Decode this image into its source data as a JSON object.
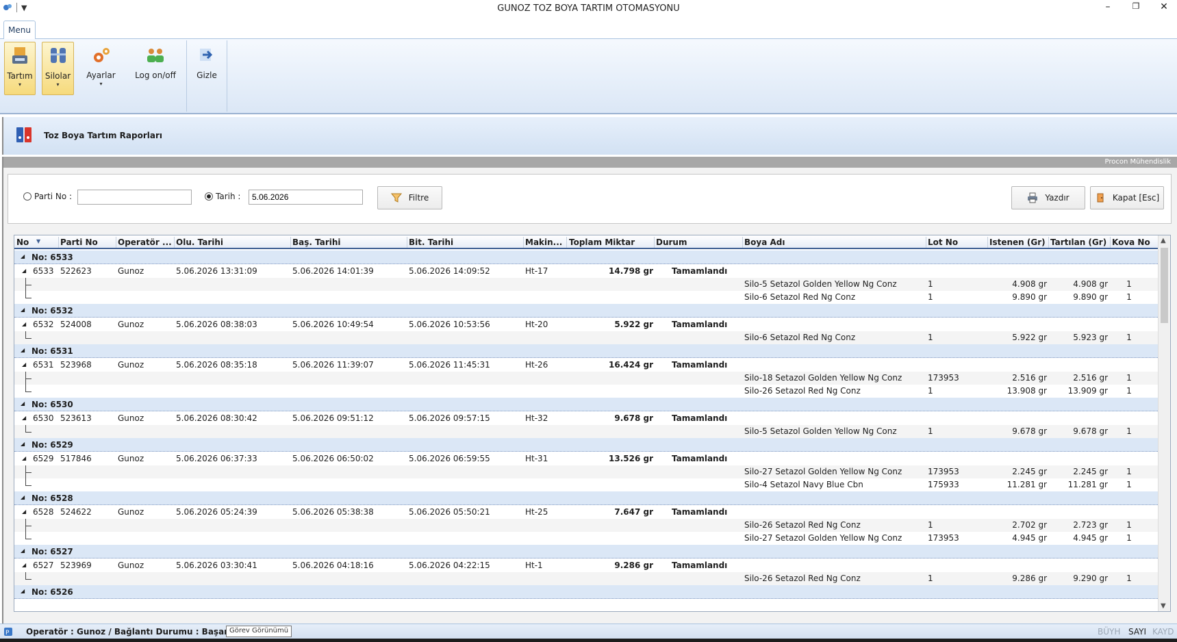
{
  "window": {
    "title": "GUNOZ TOZ BOYA TARTIM OTOMASYONU",
    "minimize": "–",
    "restore": "❐",
    "close": "✕"
  },
  "ribbon": {
    "tab": "Menu",
    "buttons": {
      "tartim": "Tartım",
      "silolar": "Silolar",
      "ayarlar": "Ayarlar",
      "log": "Log on/off",
      "gizle": "Gizle"
    },
    "dropdown_arrow": "▾"
  },
  "form": {
    "title": "Toz Boya Tartım Raporları",
    "company": "Procon Mühendislik"
  },
  "filter": {
    "parti_label": "Parti No :",
    "parti_value": "",
    "tarih_label": "Tarih :",
    "tarih_value": "5.06.2026",
    "filter_button": "Filtre",
    "print_button": "Yazdır",
    "close_button": "Kapat [Esc]",
    "selected": "tarih"
  },
  "grid": {
    "headers": {
      "no": "No",
      "parti": "Parti No",
      "operator": "Operatör ...",
      "olu": "Olu. Tarihi",
      "bas": "Baş. Tarihi",
      "bit": "Bit. Tarihi",
      "makine": "Makin...",
      "toplam": "Toplam Miktar",
      "durum": "Durum",
      "boya": "Boya Adı",
      "lot": "Lot No",
      "istenen": "Istenen (Gr)",
      "tartilan": "Tartılan (Gr)",
      "kova": "Kova No"
    },
    "groups": [
      {
        "label": "No: 6533",
        "master": {
          "no": "6533",
          "parti": "522623",
          "operator": "Gunoz",
          "olu": "5.06.2026 13:31:09",
          "bas": "5.06.2026 14:01:39",
          "bit": "5.06.2026 14:09:52",
          "makine": "Ht-17",
          "toplam": "14.798 gr",
          "durum": "Tamamlandı"
        },
        "details": [
          {
            "boya": "Silo-5 Setazol Golden Yellow Ng Conz",
            "lot": "1",
            "istenen": "4.908 gr",
            "tartilan": "4.908 gr",
            "kova": "1"
          },
          {
            "boya": "Silo-6 Setazol Red Ng Conz",
            "lot": "1",
            "istenen": "9.890 gr",
            "tartilan": "9.890 gr",
            "kova": "1"
          }
        ]
      },
      {
        "label": "No: 6532",
        "master": {
          "no": "6532",
          "parti": "524008",
          "operator": "Gunoz",
          "olu": "5.06.2026 08:38:03",
          "bas": "5.06.2026 10:49:54",
          "bit": "5.06.2026 10:53:56",
          "makine": "Ht-20",
          "toplam": "5.922 gr",
          "durum": "Tamamlandı"
        },
        "details": [
          {
            "boya": "Silo-6 Setazol Red Ng Conz",
            "lot": "1",
            "istenen": "5.922 gr",
            "tartilan": "5.923 gr",
            "kova": "1"
          }
        ]
      },
      {
        "label": "No: 6531",
        "master": {
          "no": "6531",
          "parti": "523968",
          "operator": "Gunoz",
          "olu": "5.06.2026 08:35:18",
          "bas": "5.06.2026 11:39:07",
          "bit": "5.06.2026 11:45:31",
          "makine": "Ht-26",
          "toplam": "16.424 gr",
          "durum": "Tamamlandı"
        },
        "details": [
          {
            "boya": "Silo-18 Setazol Golden Yellow Ng Conz",
            "lot": "173953",
            "istenen": "2.516 gr",
            "tartilan": "2.516 gr",
            "kova": "1"
          },
          {
            "boya": "Silo-26 Setazol Red Ng Conz",
            "lot": "1",
            "istenen": "13.908 gr",
            "tartilan": "13.909 gr",
            "kova": "1"
          }
        ]
      },
      {
        "label": "No: 6530",
        "master": {
          "no": "6530",
          "parti": "523613",
          "operator": "Gunoz",
          "olu": "5.06.2026 08:30:42",
          "bas": "5.06.2026 09:51:12",
          "bit": "5.06.2026 09:57:15",
          "makine": "Ht-32",
          "toplam": "9.678 gr",
          "durum": "Tamamlandı"
        },
        "details": [
          {
            "boya": "Silo-5 Setazol Golden Yellow Ng Conz",
            "lot": "1",
            "istenen": "9.678 gr",
            "tartilan": "9.678 gr",
            "kova": "1"
          }
        ]
      },
      {
        "label": "No: 6529",
        "master": {
          "no": "6529",
          "parti": "517846",
          "operator": "Gunoz",
          "olu": "5.06.2026 06:37:33",
          "bas": "5.06.2026 06:50:02",
          "bit": "5.06.2026 06:59:55",
          "makine": "Ht-31",
          "toplam": "13.526 gr",
          "durum": "Tamamlandı"
        },
        "details": [
          {
            "boya": "Silo-27 Setazol Golden Yellow Ng Conz",
            "lot": "173953",
            "istenen": "2.245 gr",
            "tartilan": "2.245 gr",
            "kova": "1"
          },
          {
            "boya": "Silo-4 Setazol Navy Blue Cbn",
            "lot": "175933",
            "istenen": "11.281 gr",
            "tartilan": "11.281 gr",
            "kova": "1"
          }
        ]
      },
      {
        "label": "No: 6528",
        "master": {
          "no": "6528",
          "parti": "524622",
          "operator": "Gunoz",
          "olu": "5.06.2026 05:24:39",
          "bas": "5.06.2026 05:38:38",
          "bit": "5.06.2026 05:50:21",
          "makine": "Ht-25",
          "toplam": "7.647 gr",
          "durum": "Tamamlandı"
        },
        "details": [
          {
            "boya": "Silo-26 Setazol Red Ng Conz",
            "lot": "1",
            "istenen": "2.702 gr",
            "tartilan": "2.723 gr",
            "kova": "1"
          },
          {
            "boya": "Silo-27 Setazol Golden Yellow Ng Conz",
            "lot": "173953",
            "istenen": "4.945 gr",
            "tartilan": "4.945 gr",
            "kova": "1"
          }
        ]
      },
      {
        "label": "No: 6527",
        "master": {
          "no": "6527",
          "parti": "523969",
          "operator": "Gunoz",
          "olu": "5.06.2026 03:30:41",
          "bas": "5.06.2026 04:18:16",
          "bit": "5.06.2026 04:22:15",
          "makine": "Ht-1",
          "toplam": "9.286 gr",
          "durum": "Tamamlandı"
        },
        "details": [
          {
            "boya": "Silo-26 Setazol Red Ng Conz",
            "lot": "1",
            "istenen": "9.286 gr",
            "tartilan": "9.290 gr",
            "kova": "1"
          }
        ]
      },
      {
        "label": "No: 6526",
        "master": null,
        "details": []
      }
    ]
  },
  "status": {
    "text": "Operatör :  Gunoz / Bağlantı Durumu :  Başarılı",
    "tooltip": "Görev Görünümü",
    "caps": "BÜYH",
    "num": "SAYI",
    "scroll": "KAYD"
  }
}
